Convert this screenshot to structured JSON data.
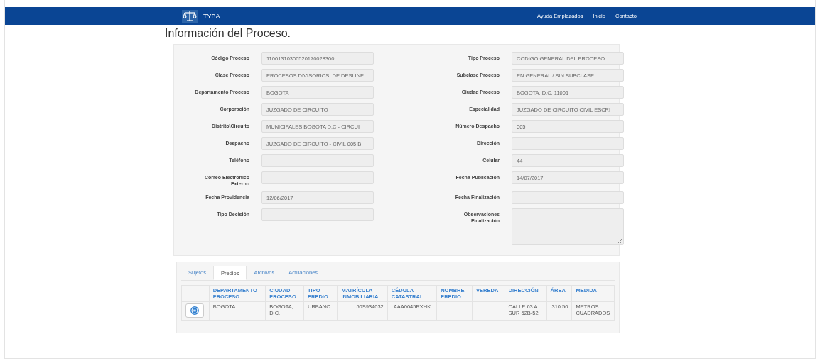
{
  "navbar": {
    "brand": "TYBA",
    "links": [
      "Ayuda Emplazados",
      "Inicio",
      "Contacto"
    ]
  },
  "title": "Información del Proceso.",
  "fields": [
    {
      "label": "Código Proceso",
      "value": "11001310300520170028300",
      "kind": "input"
    },
    {
      "label": "Tipo Proceso",
      "value": "CODIGO GENERAL DEL PROCESO",
      "kind": "input"
    },
    {
      "label": "Clase Proceso",
      "value": "PROCESOS DIVISORIOS, DE DESLINE",
      "kind": "input"
    },
    {
      "label": "Subclase Proceso",
      "value": "EN GENERAL / SIN SUBCLASE",
      "kind": "input"
    },
    {
      "label": "Departamento Proceso",
      "value": "BOGOTA",
      "kind": "input"
    },
    {
      "label": "Ciudad Proceso",
      "value": "BOGOTA, D.C. 11001",
      "kind": "input"
    },
    {
      "label": "Corporación",
      "value": "JUZGADO DE CIRCUITO",
      "kind": "input"
    },
    {
      "label": "Especialidad",
      "value": "JUZGADO DE CIRCUITO  CIVIL ESCRI",
      "kind": "input"
    },
    {
      "label": "Distrito\\Circuito",
      "value": "MUNICIPALES BOGOTA D.C  - CIRCUI",
      "kind": "input"
    },
    {
      "label": "Número Despacho",
      "value": "005",
      "kind": "input"
    },
    {
      "label": "Despacho",
      "value": "JUZGADO DE CIRCUITO - CIVIL 005 B",
      "kind": "input"
    },
    {
      "label": "Dirección",
      "kind": "input"
    },
    {
      "label": "Teléfono",
      "kind": "input"
    },
    {
      "label": "Celular",
      "value": "44",
      "kind": "input"
    },
    {
      "label": "Correo Electrónico Externo",
      "kind": "input"
    },
    {
      "label": "Fecha Publicación",
      "value": "14/07/2017",
      "kind": "input"
    },
    {
      "label": "Fecha Providencia",
      "value": "12/06/2017",
      "kind": "input"
    },
    {
      "label": "Fecha Finalización",
      "kind": "input"
    },
    {
      "label": "Tipo Decisión",
      "kind": "input"
    },
    {
      "label": "Observaciones Finalización",
      "kind": "textarea"
    }
  ],
  "tabs": [
    {
      "label": "Sujetos",
      "selected": false
    },
    {
      "label": "Predios",
      "selected": true
    },
    {
      "label": "Archivos",
      "selected": false
    },
    {
      "label": "Actuaciones",
      "selected": false
    }
  ],
  "table": {
    "columns": [
      "DEPARTAMENTO PROCESO",
      "CIUDAD PROCESO",
      "TIPO PREDIO",
      "MATRÍCULA INMOBILIARIA",
      "CÉDULA CATASTRAL",
      "NOMBRE PREDIO",
      "VEREDA",
      "DIRECCIÓN",
      "ÁREA",
      "MEDIDA"
    ],
    "rows": [
      [
        "BOGOTA",
        "BOGOTA, D.C.",
        "URBANO",
        "50S934032",
        "AAA0045RXHK",
        "",
        "",
        "CALLE 63 A SUR 52B-52",
        "310.50",
        "METROS CUADRADOS"
      ]
    ]
  }
}
